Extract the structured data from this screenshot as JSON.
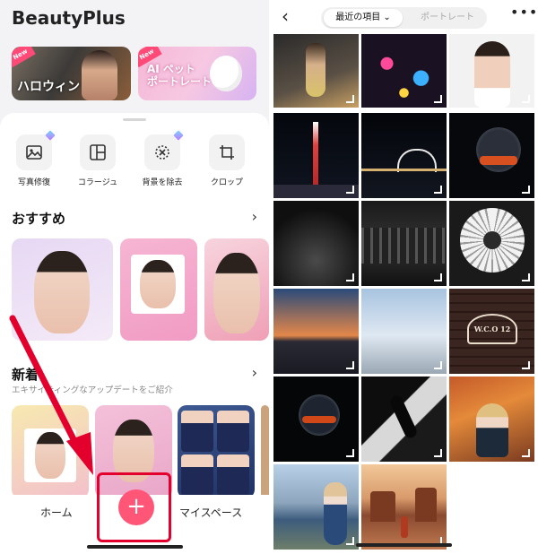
{
  "left": {
    "app_title": "BeautyPlus",
    "banners": [
      {
        "tag": "New",
        "title": "ハロウィン"
      },
      {
        "tag": "New",
        "title_line1": "AI ペット",
        "title_line2": "ポートレート"
      }
    ],
    "tools": [
      {
        "label": "写真修復",
        "icon": "photo-restore-icon"
      },
      {
        "label": "コラージュ",
        "icon": "collage-icon"
      },
      {
        "label": "背景を除去",
        "icon": "remove-background-icon"
      },
      {
        "label": "クロップ",
        "icon": "crop-icon"
      }
    ],
    "recommended": {
      "title": "おすすめ",
      "chevron": "›"
    },
    "whats_new": {
      "title": "新着",
      "subtitle": "エキサイティングなアップデートをご紹介",
      "chevron": "›"
    },
    "bottom_nav": {
      "home": "ホーム",
      "plus": "+",
      "my_space": "マイスペース"
    },
    "colors": {
      "accent": "#ff5577",
      "highlight_box": "#e3002c",
      "arrow": "#e3002c"
    }
  },
  "right": {
    "back": "‹",
    "tabs": {
      "active": "最近の項目",
      "active_chevron": "⌄",
      "inactive": "ポートレート"
    },
    "more": "•••",
    "thumbnails": [
      {
        "name": "woman-night-street"
      },
      {
        "name": "neon-reflections"
      },
      {
        "name": "woman-portrait"
      },
      {
        "name": "skytree-night"
      },
      {
        "name": "rainbow-bridge-night"
      },
      {
        "name": "city-skyline-night"
      },
      {
        "name": "leaves-mono"
      },
      {
        "name": "city-lights-mono"
      },
      {
        "name": "daisy-mono"
      },
      {
        "name": "sunset-city"
      },
      {
        "name": "sky-sea"
      },
      {
        "name": "brick-wall-sign"
      },
      {
        "name": "moon-skyline"
      },
      {
        "name": "shadow-silhouette"
      },
      {
        "name": "autumn-woman"
      },
      {
        "name": "cliff-woman"
      },
      {
        "name": "desert-man"
      }
    ],
    "sign_text": "W.C.O 12"
  }
}
